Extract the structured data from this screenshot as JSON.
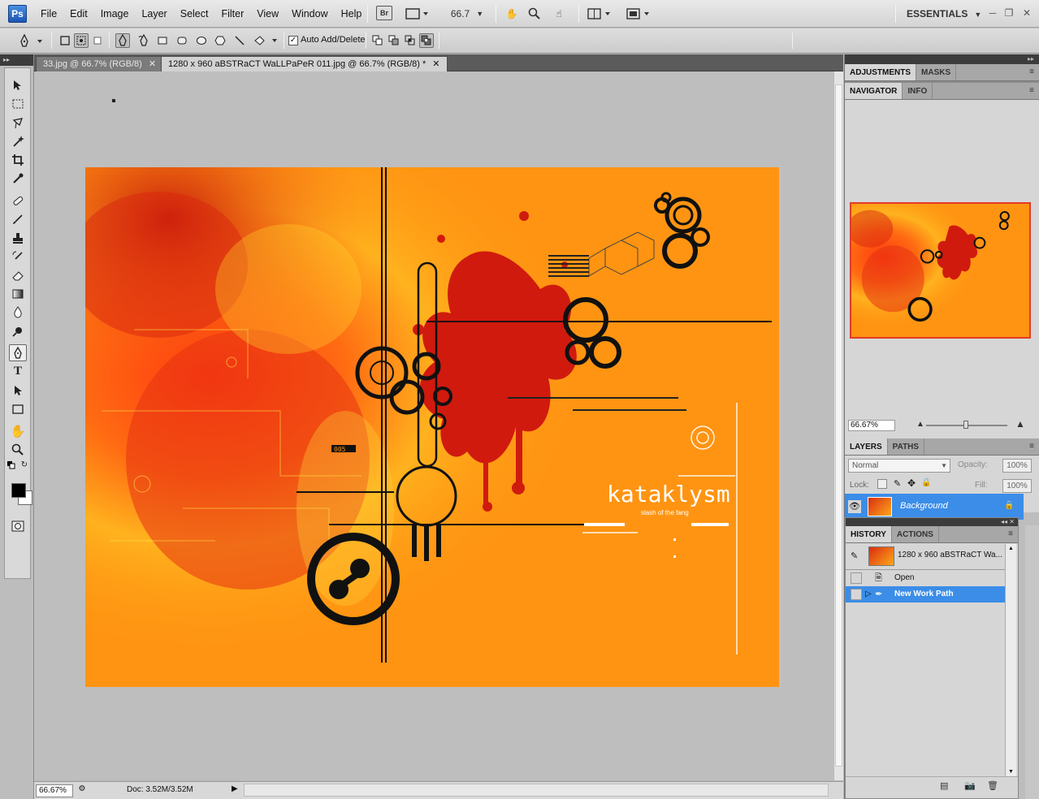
{
  "app": {
    "logo": "Ps"
  },
  "menu": [
    "File",
    "Edit",
    "Image",
    "Layer",
    "Select",
    "Filter",
    "View",
    "Window",
    "Help"
  ],
  "menubar": {
    "bridge_label": "Br",
    "zoom_value": "66.7",
    "workspace": "ESSENTIALS"
  },
  "options": {
    "auto_add_delete": "Auto Add/Delete",
    "auto_add_checked": true
  },
  "tabs": [
    {
      "label": "33.jpg @ 66.7% (RGB/8)",
      "active": false
    },
    {
      "label": "1280 x 960 aBSTRaCT WaLLPaPeR 011.jpg @ 66.7% (RGB/8) *",
      "active": true
    }
  ],
  "artwork": {
    "text": "kataklysm",
    "subtext": "slash of the fang",
    "tag": "005"
  },
  "status": {
    "zoom": "66.67%",
    "doc": "Doc: 3.52M/3.52M"
  },
  "panels": {
    "adjustments_tabs": [
      "ADJUSTMENTS",
      "MASKS"
    ],
    "navigator_tabs": [
      "NAVIGATOR",
      "INFO"
    ],
    "navigator_zoom": "66.67%",
    "layers_tabs": [
      "LAYERS",
      "PATHS"
    ],
    "blend_mode": "Normal",
    "opacity_label": "Opacity:",
    "opacity_value": "100%",
    "lock_label": "Lock:",
    "fill_label": "Fill:",
    "fill_value": "100%",
    "layer_name": "Background",
    "history_tabs": [
      "HISTORY",
      "ACTIONS"
    ],
    "history_snapshot": "1280 x 960 aBSTRaCT Wa...",
    "history_items": [
      {
        "label": "Open",
        "active": false
      },
      {
        "label": "New Work Path",
        "active": true
      }
    ]
  },
  "colors": {
    "accent": "#3b8de8",
    "artwork_orange": "#ff9412",
    "artwork_red": "#d41c0f"
  }
}
